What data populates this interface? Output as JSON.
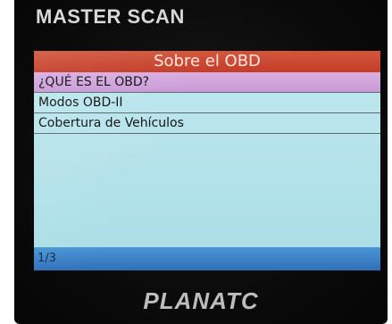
{
  "device": {
    "brand_top": "MASTER SCAN",
    "brand_bottom": "PLANATC"
  },
  "screen": {
    "title": "Sobre el OBD",
    "menu": [
      {
        "label": "¿QUÉ ES EL OBD?",
        "selected": true
      },
      {
        "label": "Modos OBD-II",
        "selected": false
      },
      {
        "label": "Cobertura de Vehículos",
        "selected": false
      }
    ],
    "page_indicator": "1/3"
  },
  "colors": {
    "title_bar": "#c94a31",
    "screen_bg": "#b8e4ec",
    "selected_row": "#d1a4dc",
    "status_bar": "#3d82c6"
  }
}
